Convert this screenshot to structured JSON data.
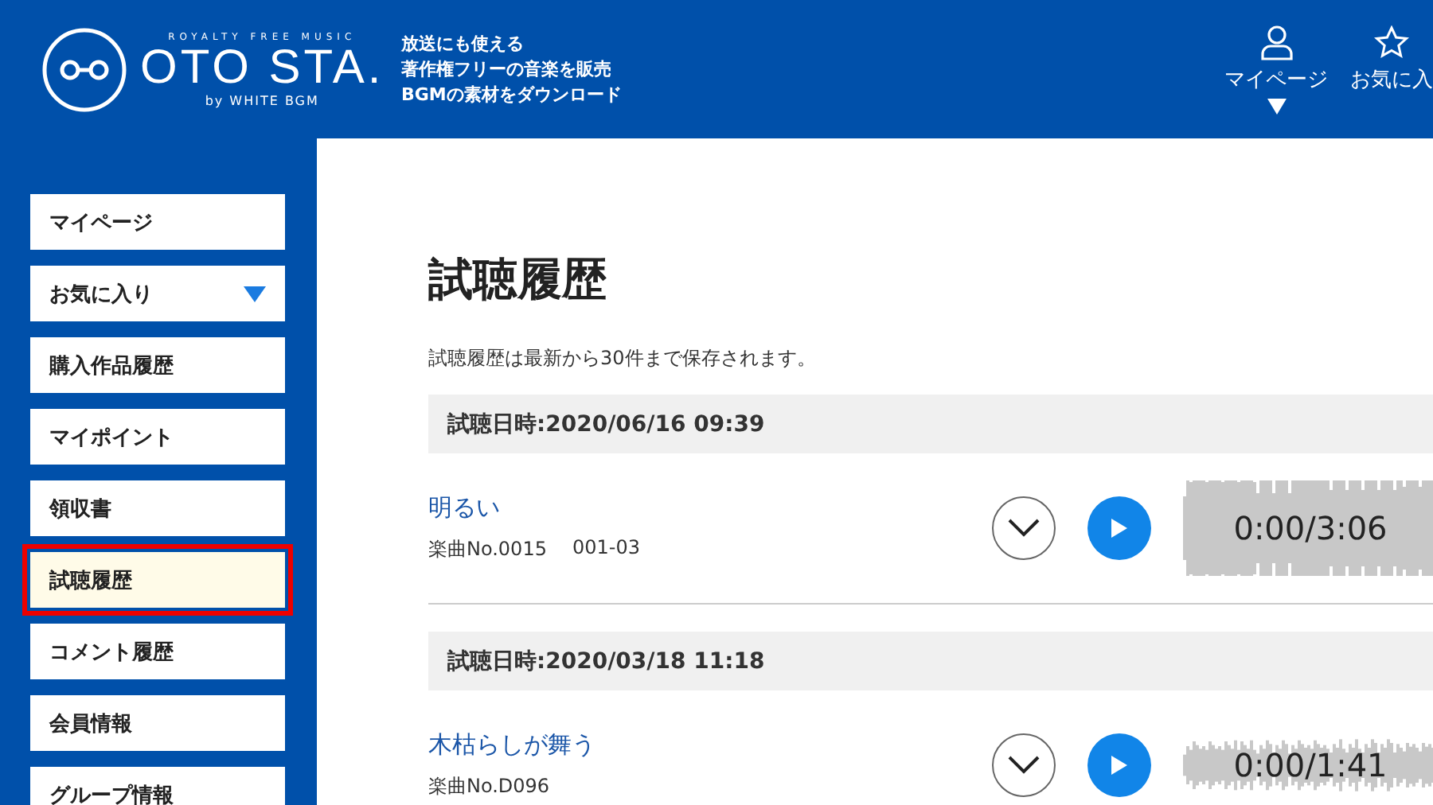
{
  "header": {
    "logo": {
      "tagline": "ROYALTY FREE MUSIC",
      "name": "OTO STA.",
      "byline": "by WHITE BGM"
    },
    "description": [
      "放送にも使える",
      "著作権フリーの音楽を販売",
      "BGMの素材をダウンロード"
    ],
    "nav": [
      {
        "kind": "user",
        "label": "マイページ",
        "dropdown": true
      },
      {
        "kind": "star",
        "label": "お気に入",
        "dropdown": false
      }
    ]
  },
  "sidebar": {
    "items": [
      {
        "label": "マイページ",
        "selected": false,
        "dropdown": false
      },
      {
        "label": "お気に入り",
        "selected": false,
        "dropdown": true
      },
      {
        "label": "購入作品履歴",
        "selected": false,
        "dropdown": false
      },
      {
        "label": "マイポイント",
        "selected": false,
        "dropdown": false
      },
      {
        "label": "領収書",
        "selected": false,
        "dropdown": false
      },
      {
        "label": "試聴履歴",
        "selected": true,
        "dropdown": false
      },
      {
        "label": "コメント履歴",
        "selected": false,
        "dropdown": false
      },
      {
        "label": "会員情報",
        "selected": false,
        "dropdown": false
      },
      {
        "label": "グループ情報",
        "selected": false,
        "dropdown": false
      }
    ]
  },
  "main": {
    "title": "試聴履歴",
    "note": "試聴履歴は最新から30件まで保存されます。",
    "entries": [
      {
        "date": "試聴日時:2020/06/16 09:39",
        "track": "明るい",
        "number": "楽曲No.0015",
        "code": "001-03",
        "time": "0:00/3:06"
      },
      {
        "date": "試聴日時:2020/03/18 11:18",
        "track": "木枯らしが舞う",
        "number": "楽曲No.D096",
        "time": "0:00/1:41"
      }
    ]
  }
}
